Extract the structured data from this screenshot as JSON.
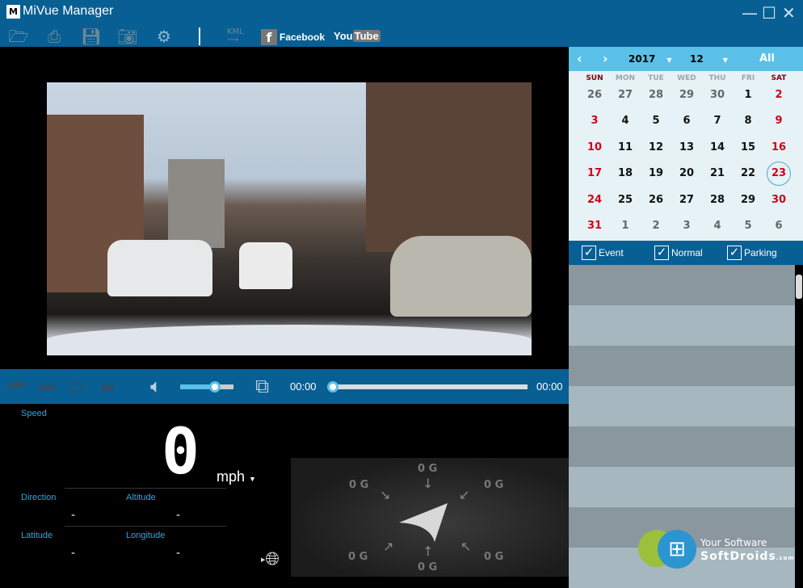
{
  "title": "MiVue Manager",
  "logo": "M",
  "window_controls": [
    "minimize",
    "maximize",
    "close"
  ],
  "toolbar": {
    "kml": "KML",
    "facebook": "Facebook",
    "youtube_you": "You",
    "youtube_tube": "Tube"
  },
  "player": {
    "current_time": "00:00",
    "total_time": "00:00",
    "volume": 0.65,
    "progress": 0
  },
  "telemetry": {
    "speed_label": "Speed",
    "speed_value": "0",
    "unit": "mph",
    "direction_label": "Direction",
    "direction_value": "-",
    "altitude_label": "Altitude",
    "altitude_value": "-",
    "latitude_label": "Latitude",
    "latitude_value": "-",
    "longitude_label": "Longitude",
    "longitude_value": "-"
  },
  "gsensor": {
    "top": "0 G",
    "top_left": "0 G",
    "top_right": "0 G",
    "bottom": "0 G",
    "bottom_left": "0 G",
    "bottom_right": "0 G"
  },
  "calendar": {
    "year": "2017",
    "month": "12",
    "all": "All",
    "weekdays": [
      "SUN",
      "MON",
      "TUE",
      "WED",
      "THU",
      "FRI",
      "SAT"
    ],
    "weeks": [
      [
        "26",
        "27",
        "28",
        "29",
        "30",
        "1",
        "2"
      ],
      [
        "3",
        "4",
        "5",
        "6",
        "7",
        "8",
        "9"
      ],
      [
        "10",
        "11",
        "12",
        "13",
        "14",
        "15",
        "16"
      ],
      [
        "17",
        "18",
        "19",
        "20",
        "21",
        "22",
        "23"
      ],
      [
        "24",
        "25",
        "26",
        "27",
        "28",
        "29",
        "30"
      ],
      [
        "31",
        "1",
        "2",
        "3",
        "4",
        "5",
        "6"
      ]
    ],
    "selected": "23"
  },
  "filters": [
    {
      "label": "Event",
      "checked": true
    },
    {
      "label": "Normal",
      "checked": true
    },
    {
      "label": "Parking",
      "checked": true
    }
  ],
  "watermark": {
    "line1": "Your Software",
    "line2": "SoftDroids",
    ".com": ".com"
  },
  "colors": {
    "accent": "#085f93",
    "calendar_header": "#5bc0e8",
    "weekend": "#d0021b"
  }
}
